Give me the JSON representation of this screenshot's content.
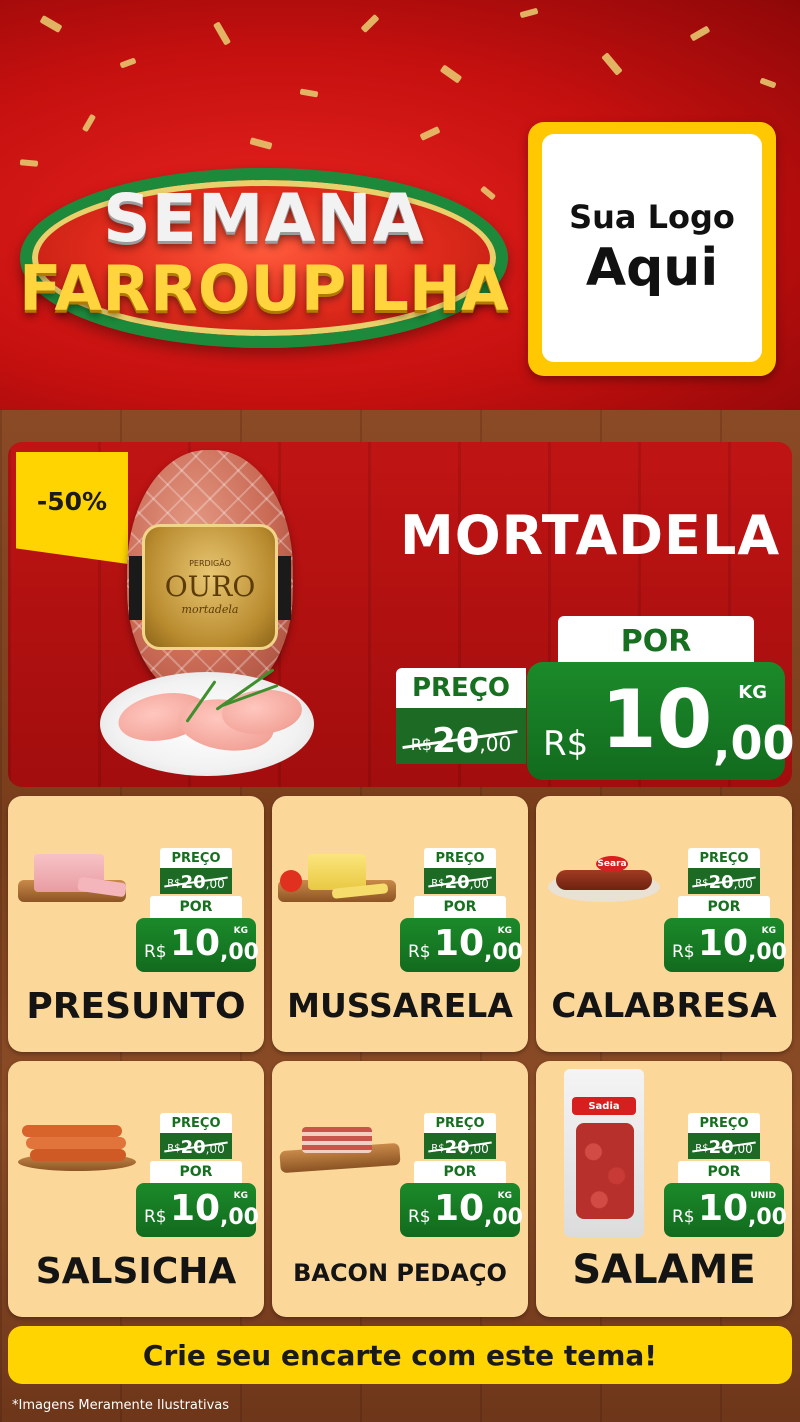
{
  "header": {
    "title_line1": "SEMANA",
    "title_line2": "FARROUPILHA",
    "logo_line1": "Sua Logo",
    "logo_line2": "Aqui"
  },
  "hero": {
    "discount": "-50%",
    "product_name": "MORTADELA",
    "brand": "PERDIGÃO",
    "brand_line": "OURO",
    "brand_sub": "mortadela",
    "por_label": "POR",
    "preco_label": "PREÇO",
    "old_currency": "R$",
    "old_int": "20",
    "old_dec": ",00",
    "currency": "R$",
    "price_int": "10",
    "price_dec": ",00",
    "unit": "KG"
  },
  "products": [
    {
      "name": "PRESUNTO",
      "preco_label": "PREÇO",
      "old_currency": "R$",
      "old_int": "20",
      "old_dec": ",00",
      "por_label": "POR",
      "currency": "R$",
      "price_int": "10",
      "price_dec": ",00",
      "unit": "KG"
    },
    {
      "name": "MUSSARELA",
      "preco_label": "PREÇO",
      "old_currency": "R$",
      "old_int": "20",
      "old_dec": ",00",
      "por_label": "POR",
      "currency": "R$",
      "price_int": "10",
      "price_dec": ",00",
      "unit": "KG"
    },
    {
      "name": "CALABRESA",
      "brand": "Seara",
      "preco_label": "PREÇO",
      "old_currency": "R$",
      "old_int": "20",
      "old_dec": ",00",
      "por_label": "POR",
      "currency": "R$",
      "price_int": "10",
      "price_dec": ",00",
      "unit": "KG"
    },
    {
      "name": "SALSICHA",
      "preco_label": "PREÇO",
      "old_currency": "R$",
      "old_int": "20",
      "old_dec": ",00",
      "por_label": "POR",
      "currency": "R$",
      "price_int": "10",
      "price_dec": ",00",
      "unit": "KG"
    },
    {
      "name": "BACON PEDAÇO",
      "preco_label": "PREÇO",
      "old_currency": "R$",
      "old_int": "20",
      "old_dec": ",00",
      "por_label": "POR",
      "currency": "R$",
      "price_int": "10",
      "price_dec": ",00",
      "unit": "KG"
    },
    {
      "name": "SALAME",
      "brand": "Sadia",
      "preco_label": "PREÇO",
      "old_currency": "R$",
      "old_int": "20",
      "old_dec": ",00",
      "por_label": "POR",
      "currency": "R$",
      "price_int": "10",
      "price_dec": ",00",
      "unit": "UNID"
    }
  ],
  "footer": {
    "cta": "Crie seu encarte com este tema!",
    "disclaimer": "*Imagens Meramente Ilustrativas"
  },
  "colors": {
    "header_red": "#c4100f",
    "accent_yellow": "#ffd400",
    "price_green": "#1b8a2a",
    "card_bg": "#fbd89a",
    "wood": "#7a3e1c"
  }
}
